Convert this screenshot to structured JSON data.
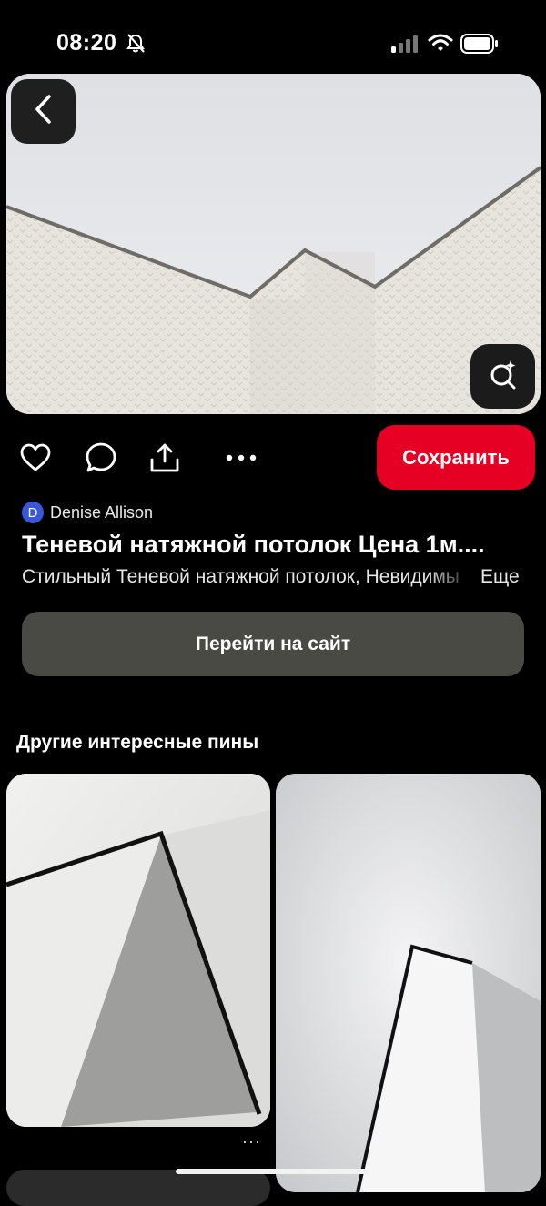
{
  "status_bar": {
    "time": "08:20"
  },
  "actions": {
    "save_label": "Сохранить"
  },
  "pin": {
    "author_initial": "D",
    "author_name": "Denise Allison",
    "title": "Теневой натяжной потолок Цена 1м....",
    "description": "Стильный Теневой натяжной потолок, Невидимый",
    "more_label": "Еще",
    "visit_site_label": "Перейти на сайт"
  },
  "related": {
    "heading": "Другие интересные пины",
    "more_glyph": "···"
  },
  "colors": {
    "save_red": "#e60023",
    "visit_button": "#4a4a45",
    "author_avatar": "#3b57d9",
    "background": "#000000"
  },
  "icons": [
    "bell-slash-icon",
    "signal-icon",
    "wifi-icon",
    "battery-icon",
    "back-chevron-icon",
    "visual-search-icon",
    "heart-icon",
    "comment-icon",
    "share-icon",
    "more-icon"
  ]
}
